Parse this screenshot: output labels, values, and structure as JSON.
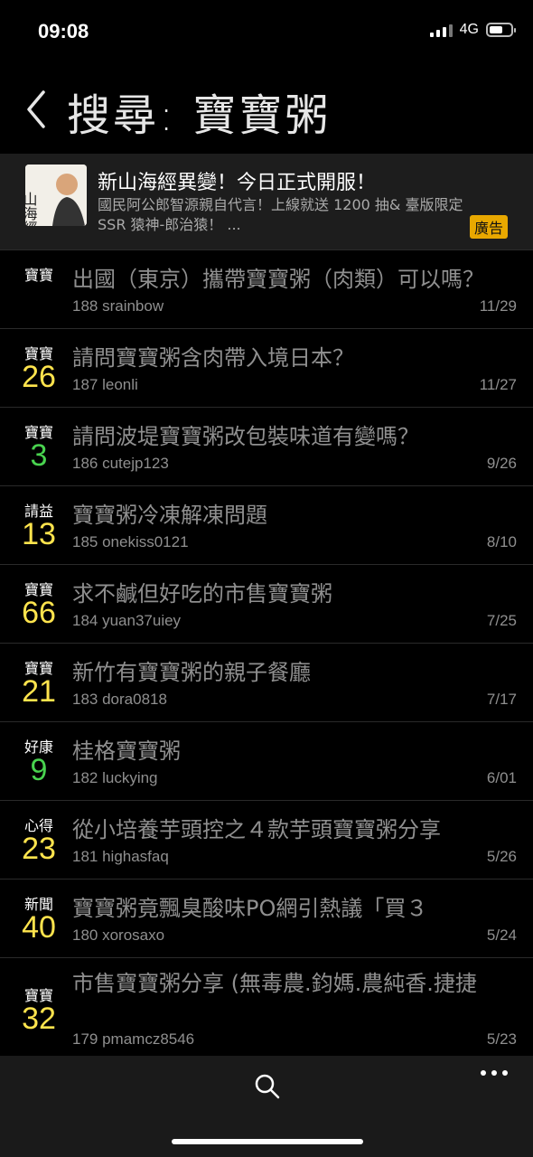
{
  "status": {
    "time": "09:08",
    "network": "4G"
  },
  "header": {
    "title": "搜尋: 寶寶粥"
  },
  "ad": {
    "thumb_text": "山海經",
    "title": "新山海經異變！今日正式開服！",
    "desc": "國民阿公郎智源親自代言！上線就送 1200 抽& 臺版限定 SSR 猿神-郎治猿！ ...",
    "badge": "廣告"
  },
  "posts": [
    {
      "category": "寶寶",
      "count": "",
      "title": "出國（東京）攜帶寶寶粥（肉類）可以嗎？",
      "meta": "188  srainbow",
      "date": "11/29",
      "color": "yellow"
    },
    {
      "category": "寶寶",
      "count": "26",
      "title": "請問寶寶粥含肉帶入境日本？",
      "meta": "187  leonli",
      "date": "11/27",
      "color": "yellow"
    },
    {
      "category": "寶寶",
      "count": "3",
      "title": "請問波堤寶寶粥改包裝味道有變嗎？",
      "meta": "186  cutejp123",
      "date": "9/26",
      "color": "green"
    },
    {
      "category": "請益",
      "count": "13",
      "title": "寶寶粥冷凍解凍問題",
      "meta": "185  onekiss0121",
      "date": "8/10",
      "color": "yellow"
    },
    {
      "category": "寶寶",
      "count": "66",
      "title": "求不鹹但好吃的市售寶寶粥",
      "meta": "184  yuan37uiey",
      "date": "7/25",
      "color": "yellow"
    },
    {
      "category": "寶寶",
      "count": "21",
      "title": "新竹有寶寶粥的親子餐廳",
      "meta": "183  dora0818",
      "date": "7/17",
      "color": "yellow"
    },
    {
      "category": "好康",
      "count": "9",
      "title": "桂格寶寶粥",
      "meta": "182  luckying",
      "date": "6/01",
      "color": "green"
    },
    {
      "category": "心得",
      "count": "23",
      "title": "從小培養芋頭控之４款芋頭寶寶粥分享",
      "meta": "181  highasfaq",
      "date": "5/26",
      "color": "yellow"
    },
    {
      "category": "新聞",
      "count": "40",
      "title": "寶寶粥竟飄臭酸味PO網引熱議「買３",
      "meta": "180  xorosaxo",
      "date": "5/24",
      "color": "yellow"
    },
    {
      "category": "寶寶",
      "count": "32",
      "title": "市售寶寶粥分享 (無毒農.鈞媽.農純香.捷捷",
      "meta": "179  pmamcz8546",
      "date": "5/23",
      "color": "yellow"
    }
  ],
  "colors": {
    "yellow": "#ffe44d",
    "green": "#49d34f",
    "background": "#000000",
    "ad_badge": "#e8a800"
  },
  "icons": {
    "back": "chevron-left-icon",
    "search": "search-icon",
    "more": "more-dots-icon"
  }
}
